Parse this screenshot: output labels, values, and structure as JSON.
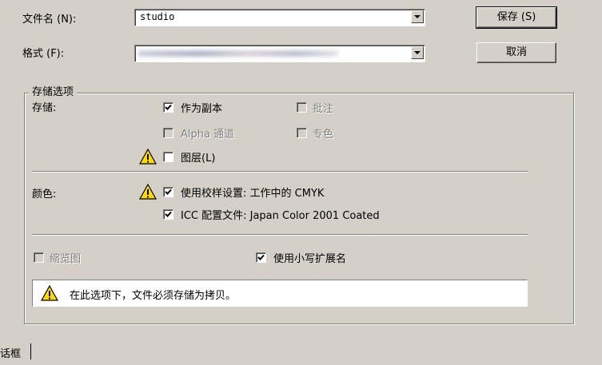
{
  "filename": {
    "label": "文件名 (N):",
    "value": "studio"
  },
  "format": {
    "label": "格式 (F):",
    "value_obscured": true
  },
  "buttons": {
    "save": "保存 (S)",
    "cancel": "取消"
  },
  "options": {
    "group_title": "存储选项",
    "save_label": "存储:",
    "as_copy": {
      "text": "作为副本",
      "checked": true,
      "enabled": true
    },
    "annotations": {
      "text": "批注",
      "checked": false,
      "enabled": false
    },
    "alpha": {
      "text": "Alpha 通道",
      "checked": false,
      "enabled": false
    },
    "spot": {
      "text": "专色",
      "checked": false,
      "enabled": false
    },
    "layers": {
      "text": "图层(L)",
      "checked": false,
      "enabled": true
    },
    "color_label": "颜色:",
    "proof": {
      "text": "使用校样设置: 工作中的 CMYK",
      "checked": true
    },
    "icc": {
      "text": "ICC 配置文件: Japan Color 2001 Coated",
      "checked": true
    },
    "thumbnail": {
      "text": "缩览图",
      "checked": false,
      "enabled": false
    },
    "lowercase": {
      "text": "使用小写扩展名",
      "checked": true
    }
  },
  "warning": "在此选项下，文件必须存储为拷贝。",
  "footer_fragment": "话框",
  "icons": {
    "warning": "warning-triangle-icon",
    "check": "checkmark-icon"
  }
}
